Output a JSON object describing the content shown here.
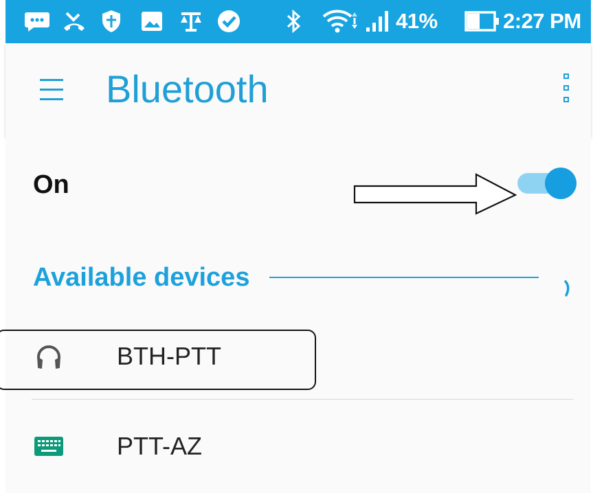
{
  "status_bar": {
    "battery_percent": "41%",
    "time": "2:27 PM",
    "icons": [
      "messages-icon",
      "missed-call-icon",
      "shield-icon",
      "image-icon",
      "scales-icon",
      "check-circle-icon",
      "bluetooth-icon",
      "wifi-icon",
      "signal-icon",
      "battery-icon"
    ],
    "color": "#17a4e0"
  },
  "app_bar": {
    "title": "Bluetooth",
    "menu_icon": "hamburger-menu-icon",
    "overflow_icon": "overflow-menu-icon",
    "accent": "#1f9fd6"
  },
  "bluetooth_toggle": {
    "label": "On",
    "state": "on"
  },
  "available_devices": {
    "heading": "Available devices",
    "scanning": true,
    "devices": [
      {
        "name": "BTH-PTT",
        "icon": "headphones-icon",
        "highlighted": true
      },
      {
        "name": "PTT-AZ",
        "icon": "keyboard-icon",
        "icon_color": "#0d9a7a",
        "highlighted": false
      }
    ]
  }
}
